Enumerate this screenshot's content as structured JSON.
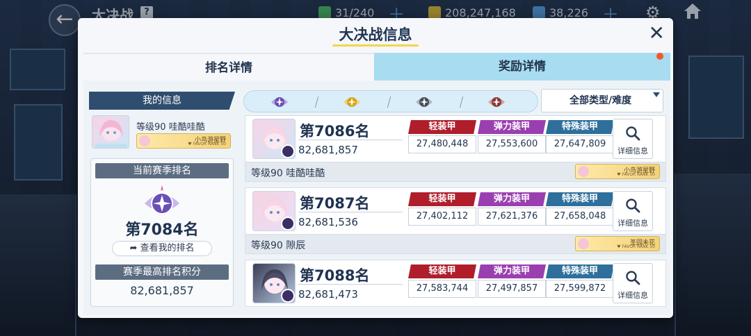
{
  "hud": {
    "title": "大决战",
    "help": "?",
    "stamina": "31/240",
    "credits": "208,247,168",
    "gems": "38,226"
  },
  "modal": {
    "title": "大决战信息",
    "close": "✕",
    "tabs": [
      {
        "label": "排名详情",
        "active": true
      },
      {
        "label": "奖励详情",
        "active": false
      }
    ]
  },
  "my_info": {
    "header": "我的信息",
    "level": "等级90",
    "name": "哇酷哇酷",
    "badge_name": "小鸟游星野",
    "badge_sub": "♥ FAVOR RANK 50",
    "season_rank_label": "当前赛季排名",
    "season_rank": "第7084名",
    "view_my_rank": "查看我的排名",
    "best_score_label": "赛季最高排名积分",
    "best_score": "82,681,857"
  },
  "filter": {
    "dropdown": "全部类型/难度",
    "emblem_colors": [
      "#6a4fb5",
      "#d9a21b",
      "#4a4f5c",
      "#8a3a3a"
    ]
  },
  "armor_labels": {
    "light": "轻装甲",
    "elastic": "弹力装甲",
    "special": "特殊装甲"
  },
  "colors": {
    "light": "#b01e2c",
    "elastic": "#9a3fb0",
    "special": "#2e6f9c"
  },
  "detail_label": "详细信息",
  "rankings": [
    {
      "place": "第7086名",
      "score": "82,681,857",
      "light": "27,480,448",
      "elastic": "27,553,600",
      "special": "27,647,809",
      "level": "等级90",
      "name": "哇酷哇酷",
      "badge_name": "小鸟游星野",
      "badge_sub": "♥ FAVOR RANK 50",
      "avatar_colors": [
        "#f7d4e6",
        "#cfe6f7"
      ]
    },
    {
      "place": "第7087名",
      "score": "82,681,536",
      "light": "27,402,112",
      "elastic": "27,621,376",
      "special": "27,658,048",
      "level": "等级90",
      "name": "隙辰",
      "badge_name": "圣园未花",
      "badge_sub": "♥ FAVOR RANK 50",
      "avatar_colors": [
        "#f6d2e4",
        "#e9e0f6"
      ]
    },
    {
      "place": "第7088名",
      "score": "82,681,473",
      "light": "27,583,744",
      "elastic": "27,497,857",
      "special": "27,599,872",
      "level": "",
      "name": "",
      "badge_name": "",
      "badge_sub": "",
      "avatar_colors": [
        "#3a3d57",
        "#b8c8e0"
      ]
    }
  ]
}
